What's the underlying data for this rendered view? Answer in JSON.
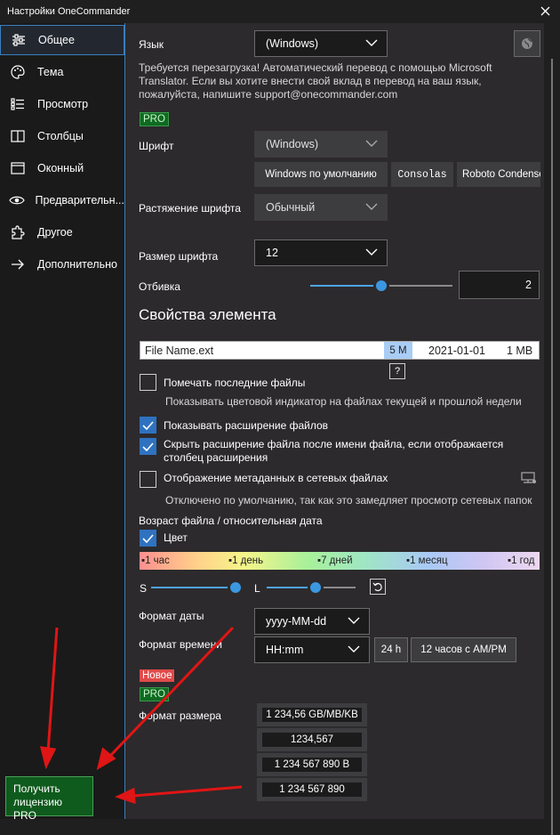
{
  "window": {
    "title": "Настройки OneCommander"
  },
  "sidebar": {
    "items": [
      {
        "label": "Общее",
        "icon": "sliders-icon"
      },
      {
        "label": "Тема",
        "icon": "palette-icon"
      },
      {
        "label": "Просмотр",
        "icon": "list-icon"
      },
      {
        "label": "Столбцы",
        "icon": "columns-icon"
      },
      {
        "label": "Оконный",
        "icon": "window-icon"
      },
      {
        "label": "Предварительн...",
        "icon": "eye-icon"
      },
      {
        "label": "Другое",
        "icon": "puzzle-icon"
      },
      {
        "label": "Дополнительно",
        "icon": "arrow-right-icon"
      }
    ],
    "pro_button": "Получить лицензию PRO"
  },
  "language": {
    "label": "Язык",
    "value": "(Windows)",
    "note": "Требуется перезагрузка! Автоматический перевод с помощью Microsoft Translator. Если вы хотите внести свой вклад в перевод на ваш язык, пожалуйста, напишите support@onecommander.com"
  },
  "pro_badge": "PRO",
  "font": {
    "label": "Шрифт",
    "value": "(Windows)",
    "presets": [
      "Windows по умолчанию",
      "Consolas",
      "Roboto Condensed"
    ]
  },
  "stretch": {
    "label": "Растяжение шрифта",
    "value": "Обычный"
  },
  "font_size": {
    "label": "Размер шрифта",
    "value": "12"
  },
  "padding": {
    "label": "Отбивка",
    "value": "2",
    "slider_fraction": 0.5
  },
  "element_props": {
    "heading": "Свойства элемента",
    "preview": {
      "name": "File Name.ext",
      "age": "5 M",
      "date": "2021-01-01",
      "size": "1 MB",
      "help": "?"
    },
    "mark_recent": {
      "label": "Помечать последние файлы",
      "note": "Показывать цветовой индикатор на файлах текущей и прошлой недели",
      "checked": false
    },
    "show_ext": {
      "label": "Показывать расширение файлов",
      "checked": true
    },
    "hide_ext": {
      "label": "Скрыть расширение файла после имени файла, если отображается столбец расширения",
      "checked": true
    },
    "metadata": {
      "label": "Отображение метаданных в сетевых файлах",
      "note": "Отключено по умолчанию, так как это замедляет просмотр сетевых папок",
      "checked": false
    }
  },
  "file_age": {
    "label": "Возраст файла / относительная дата",
    "color": {
      "label": "Цвет",
      "checked": true
    },
    "scale": [
      "▪1 час",
      "▪1 день",
      "▪7 дней",
      "▪1 месяц",
      "▪1 год"
    ],
    "s_label": "S",
    "l_label": "L",
    "s_fraction": 0.95,
    "l_fraction": 0.55
  },
  "date_format": {
    "label": "Формат даты",
    "value": "yyyy-MM-dd"
  },
  "time_format": {
    "label": "Формат времени",
    "value": "HH:mm",
    "buttons": [
      "24 h",
      "12 часов с AM/PM"
    ]
  },
  "size_format": {
    "new_badge": "Новое",
    "pro_badge": "PRO",
    "label": "Формат размера",
    "options": [
      "1 234,56 GB/MB/KB",
      "1234,567",
      "1 234 567 890 B",
      "1 234 567 890"
    ]
  },
  "colors": {
    "accent": "#3b97e0",
    "pro_green": "#0f5a1d",
    "new_red": "#e04b4b",
    "checkbox": "#2f72c0"
  }
}
